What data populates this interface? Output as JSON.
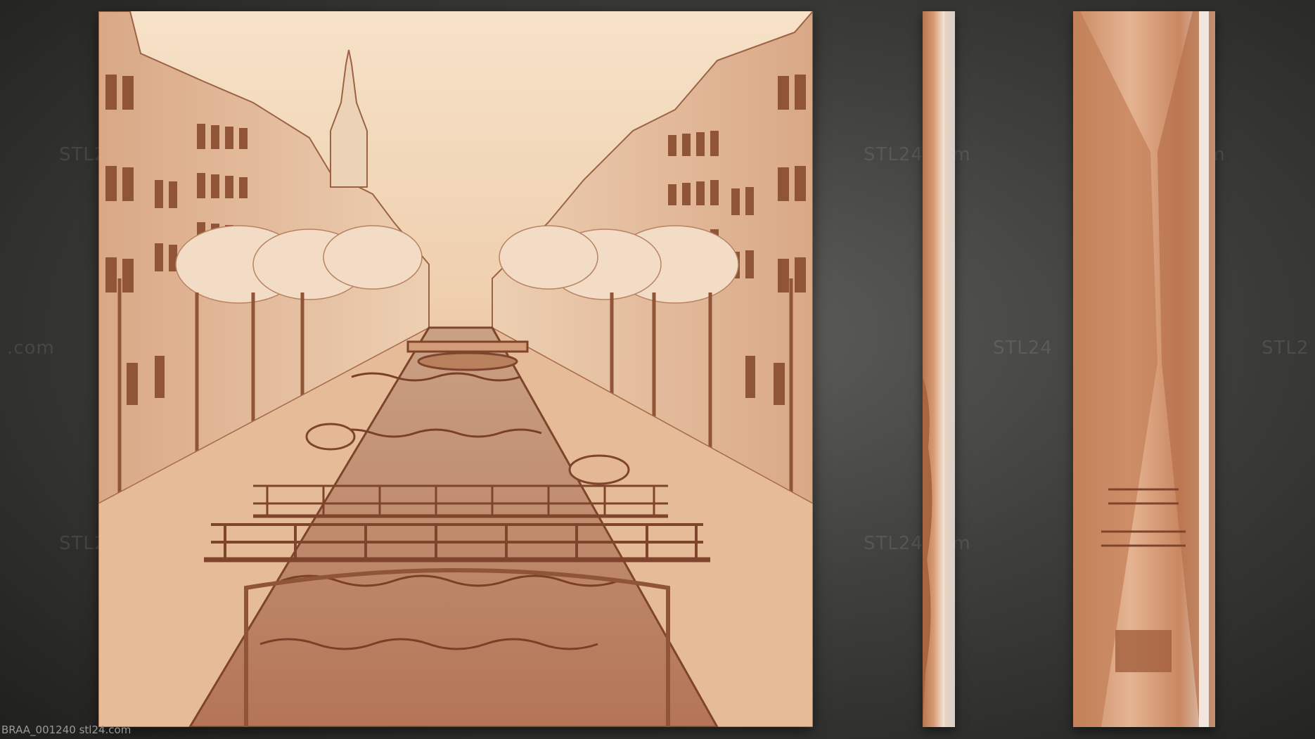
{
  "caption": "BRAA_001240 stl24.com",
  "watermarks": {
    "w1": "STL24.com",
    "w2": "STL24.com",
    "w3": "STL24.com",
    "w4": "STL24.com",
    "w5": ".com",
    "w6": "STL24.com",
    "w7": "STL24",
    "w8": "STL2"
  },
  "colors": {
    "background": "#3f3f3c",
    "relief_light": "#f6e2c8",
    "relief_mid": "#e1b08c",
    "relief_dark": "#8a4e34"
  }
}
